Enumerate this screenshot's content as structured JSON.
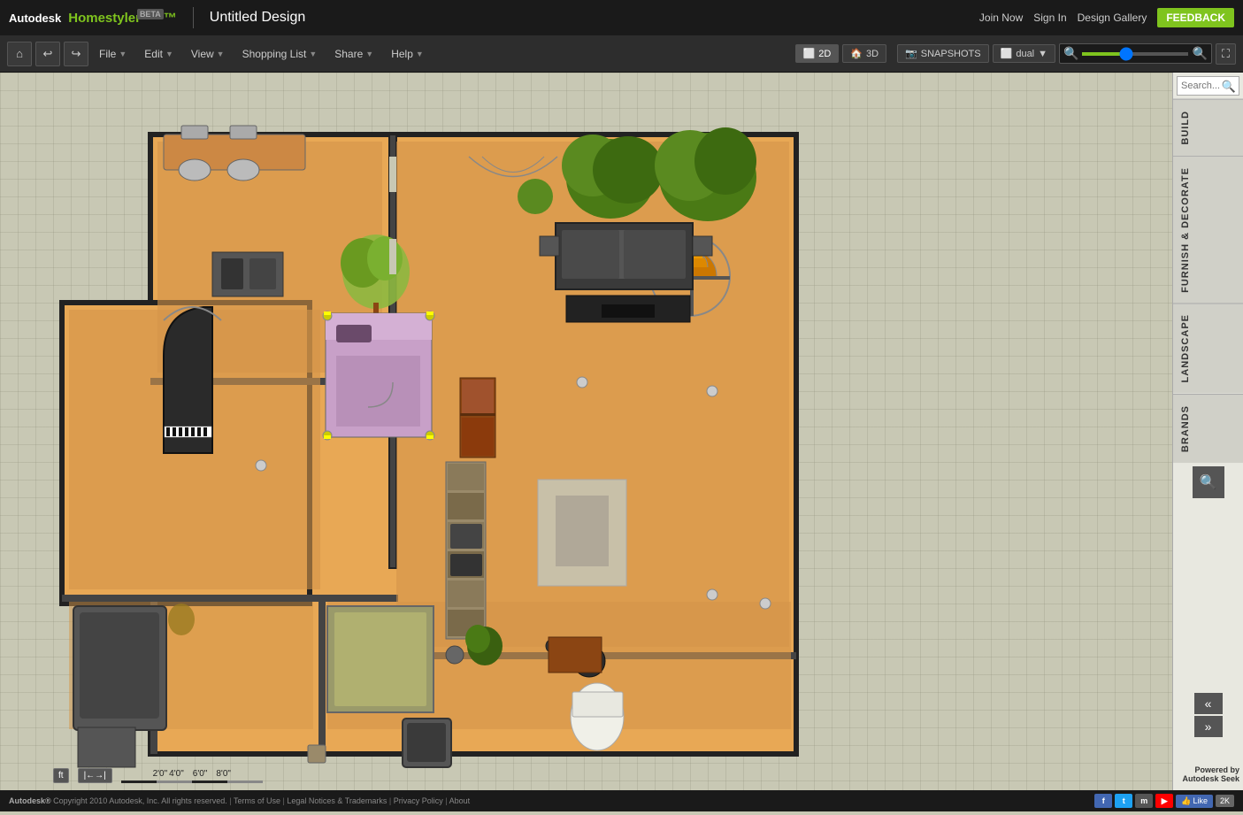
{
  "app": {
    "name": "Autodesk",
    "product": "Homestyler",
    "beta": "BETA",
    "title": "Untitled Design"
  },
  "top_nav": {
    "join_now": "Join Now",
    "sign_in": "Sign In",
    "design_gallery": "Design Gallery",
    "feedback": "FEEDBACK"
  },
  "toolbar": {
    "file": "File",
    "edit": "Edit",
    "view": "View",
    "shopping_list": "Shopping List",
    "share": "Share",
    "help": "Help",
    "mode_2d": "2D",
    "mode_3d": "3D",
    "snapshots": "SNAPSHOTS",
    "dual": "dual"
  },
  "right_panel": {
    "build_tab": "BUILD",
    "furnish_tab": "FURNISH & DECORATE",
    "landscape_tab": "LANDSCAPE",
    "brands_tab": "BRANDS",
    "search_placeholder": "Search...",
    "collapse_up": "«",
    "collapse_down": "»",
    "powered_by": "Powered by",
    "autodesk_seek": "Autodesk Seek"
  },
  "bottom_bar": {
    "unit": "ft",
    "scale_marks": [
      "2'0\"",
      "4'0\"",
      "6'0\"",
      "8'0\""
    ]
  },
  "footer": {
    "copyright": "Copyright 2010 Autodesk, Inc. All rights reserved.",
    "terms": "Terms of Use",
    "legal": "Legal Notices & Trademarks",
    "privacy": "Privacy Policy",
    "about": "About",
    "like": "Like",
    "k2": "2K"
  }
}
